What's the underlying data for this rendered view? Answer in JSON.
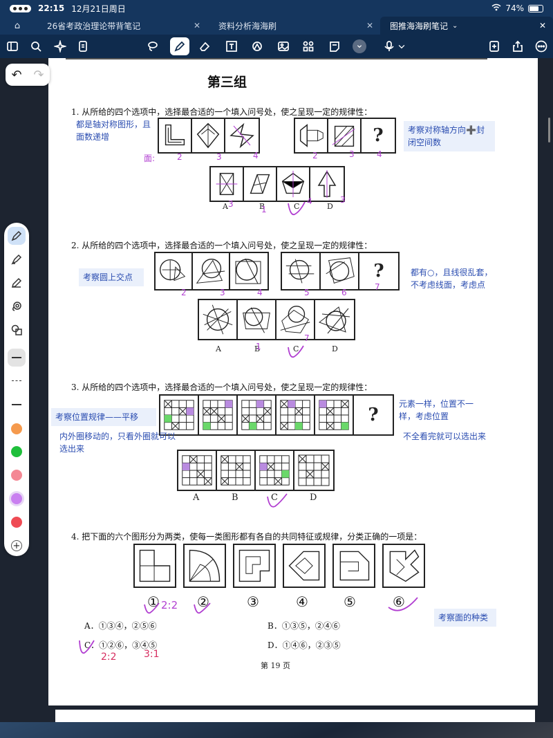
{
  "status_bar": {
    "time": "22:15",
    "date": "12月21日周日",
    "battery": "74%"
  },
  "tabs": [
    {
      "label": "26省考政治理论带背笔记",
      "active": false
    },
    {
      "label": "资料分析海海刷",
      "active": false
    },
    {
      "label": "图推海海刷笔记",
      "active": true
    }
  ],
  "toolbar": {
    "icons": [
      "sidebar-icon",
      "search-icon",
      "sparkle-icon",
      "document-icon",
      "lasso-icon",
      "pen-icon",
      "eraser-icon",
      "text-icon",
      "shape-icon",
      "image-icon",
      "sticker-icon",
      "note-icon",
      "more-circle-icon",
      "mic-icon",
      "add-page-icon",
      "share-icon",
      "more-icon"
    ],
    "selected": "pen-icon"
  },
  "document": {
    "section_title": "第三组",
    "questions": [
      {
        "number": "1.",
        "text": "从所给的四个选项中，选择最合适的一个填入问号处，使之呈现一定的规律性："
      },
      {
        "number": "2.",
        "text": "从所给的四个选项中，选择最合适的一个填入问号处，使之呈现一定的规律性："
      },
      {
        "number": "3.",
        "text": "从所给的四个选项中，选择最合适的一个填入问号处，使之呈现一定的规律性："
      },
      {
        "number": "4.",
        "text": "把下面的六个图形分为两类，使每一类图形都有各自的共同特征或规律，分类正确的一项是："
      }
    ],
    "option_letters": [
      "A",
      "B",
      "C",
      "D"
    ],
    "question_mark": "?",
    "q4_labels": [
      "①",
      "②",
      "③",
      "④",
      "⑤",
      "⑥"
    ],
    "q4_choices": {
      "A": "A．①③④，②⑤⑥",
      "B": "B．①③⑤，②④⑥",
      "C": "C．①②⑥，③④⑤",
      "D": "D．①④⑥，②③⑤"
    },
    "page_number": "第 19 页"
  },
  "notes": {
    "q1_left": "都是轴对称图形，且面数递增",
    "q1_right": "考察对称轴方向➕封闭空间数",
    "q2_left": "考察圆上交点",
    "q2_right": "都有○，且线很乱套，不考虑线面，考虑点",
    "q3_left_title": "考察位置规律——平移",
    "q3_left_body": "内外圈移动的，只看外圈就可以选出来",
    "q3_right_top": "元素一样，位置不一样，考虑位置",
    "q3_right_bottom": "不全看完就可以选出来",
    "q4_right": "考察面的种类"
  },
  "handwriting": {
    "q1_counts_left": [
      "面:",
      "2",
      "3",
      "4"
    ],
    "q1_counts_right": [
      "2",
      "3",
      "4"
    ],
    "q1_options": [
      "3",
      "1",
      "4",
      "3"
    ],
    "q2_counts_left": [
      "2",
      "3",
      "4"
    ],
    "q2_counts_right": [
      "5",
      "6",
      "7"
    ],
    "q2_options": [
      "1",
      "7"
    ],
    "q4_ratio": "2:2",
    "q4_ratio_c1": "2:2",
    "q4_ratio_c2": "3:1"
  },
  "palette": {
    "tools": [
      "pen-tool-icon",
      "highlighter-icon",
      "pencil-icon",
      "lasso-tool-icon",
      "shape-tool-icon"
    ],
    "colors": [
      "#f59a4d",
      "#1fbf3b",
      "#f48894",
      "#c97ff0",
      "#ef4b54"
    ],
    "selected_color": "#c97ff0"
  },
  "colors": {
    "status_bar": "#15365e",
    "toolbar": "#0f2b4d",
    "annotation_blue": "#2a4cb0",
    "ink_purple": "#b13fd1",
    "ink_red": "#d62e60"
  }
}
